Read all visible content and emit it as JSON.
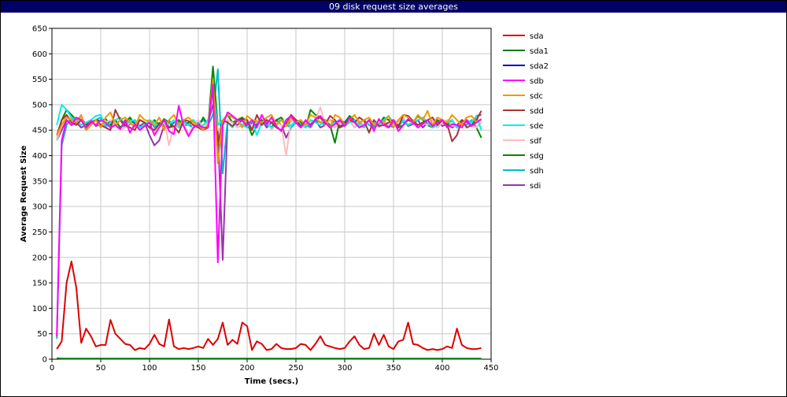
{
  "window": {
    "title": "09 disk request size averages"
  },
  "chart_data": {
    "type": "line",
    "title": "09 disk request size averages",
    "xlabel": "Time (secs.)",
    "ylabel": "Average Request Size",
    "xlim": [
      0,
      450
    ],
    "ylim": [
      0,
      650
    ],
    "x_ticks": [
      0,
      50,
      100,
      150,
      200,
      250,
      300,
      350,
      400,
      450
    ],
    "y_ticks": [
      0,
      50,
      100,
      150,
      200,
      250,
      300,
      350,
      400,
      450,
      500,
      550,
      600,
      650
    ],
    "grid": true,
    "legend_position": "right",
    "x": [
      5,
      10,
      15,
      20,
      25,
      30,
      35,
      40,
      45,
      50,
      55,
      60,
      65,
      70,
      75,
      80,
      85,
      90,
      95,
      100,
      105,
      110,
      115,
      120,
      125,
      130,
      135,
      140,
      145,
      150,
      155,
      160,
      165,
      170,
      175,
      180,
      185,
      190,
      195,
      200,
      205,
      210,
      215,
      220,
      225,
      230,
      235,
      240,
      245,
      250,
      255,
      260,
      265,
      270,
      275,
      280,
      285,
      290,
      295,
      300,
      305,
      310,
      315,
      320,
      325,
      330,
      335,
      340,
      345,
      350,
      355,
      360,
      365,
      370,
      375,
      380,
      385,
      390,
      395,
      400,
      405,
      410,
      415,
      420,
      425,
      430,
      435,
      440
    ],
    "series": [
      {
        "name": "sda",
        "color": "#dd0000",
        "values": [
          20,
          35,
          150,
          192,
          140,
          32,
          60,
          45,
          25,
          28,
          28,
          77,
          50,
          40,
          30,
          28,
          18,
          22,
          20,
          30,
          48,
          30,
          25,
          78,
          25,
          20,
          22,
          20,
          22,
          25,
          22,
          40,
          28,
          40,
          72,
          28,
          38,
          30,
          72,
          65,
          18,
          35,
          30,
          18,
          20,
          30,
          22,
          20,
          20,
          22,
          30,
          28,
          18,
          30,
          45,
          28,
          25,
          22,
          20,
          22,
          35,
          45,
          28,
          20,
          22,
          50,
          28,
          48,
          25,
          20,
          35,
          38,
          72,
          30,
          28,
          22,
          18,
          20,
          18,
          20,
          25,
          22,
          60,
          28,
          22,
          20,
          20,
          22
        ]
      },
      {
        "name": "sda1",
        "color": "#007700",
        "values": [
          2,
          1,
          1,
          1,
          1,
          1,
          1,
          1,
          1,
          1,
          1,
          1,
          1,
          1,
          1,
          1,
          1,
          1,
          1,
          1,
          1,
          1,
          1,
          1,
          1,
          1,
          1,
          1,
          1,
          1,
          1,
          1,
          1,
          1,
          1,
          1,
          1,
          1,
          1,
          1,
          1,
          1,
          1,
          1,
          1,
          1,
          1,
          1,
          1,
          1,
          1,
          1,
          1,
          1,
          1,
          1,
          1,
          1,
          1,
          1,
          1,
          1,
          1,
          1,
          1,
          1,
          1,
          1,
          1,
          1,
          1,
          1,
          1,
          1,
          1,
          1,
          1,
          1,
          1,
          1,
          1,
          1,
          1,
          1,
          1,
          1,
          1,
          1
        ]
      },
      {
        "name": "sda2",
        "color": "#0000cc",
        "values": [
          1,
          1,
          1,
          1,
          1,
          1,
          1,
          1,
          1,
          1,
          1,
          1,
          1,
          1,
          1,
          1,
          1,
          1,
          1,
          1,
          1,
          1,
          1,
          1,
          1,
          1,
          1,
          1,
          1,
          1,
          1,
          1,
          1,
          1,
          1,
          1,
          1,
          1,
          1,
          1,
          1,
          1,
          1,
          1,
          1,
          1,
          1,
          1,
          1,
          1,
          1,
          1,
          1,
          1,
          1,
          1,
          1,
          1,
          1,
          1,
          1,
          1,
          1,
          1,
          1,
          1,
          1,
          1,
          1,
          1,
          1,
          1,
          1,
          1,
          1,
          1,
          1,
          1,
          1,
          1,
          1,
          1,
          1,
          1,
          1,
          1,
          1,
          1
        ]
      },
      {
        "name": "sdb",
        "color": "#ff00ff",
        "values": [
          45,
          430,
          470,
          460,
          475,
          470,
          455,
          468,
          460,
          470,
          465,
          455,
          460,
          452,
          470,
          445,
          462,
          450,
          458,
          465,
          440,
          455,
          470,
          448,
          442,
          498,
          458,
          438,
          455,
          460,
          455,
          455,
          540,
          190,
          460,
          485,
          478,
          470,
          468,
          460,
          470,
          455,
          480,
          462,
          475,
          458,
          448,
          470,
          478,
          465,
          455,
          470,
          458,
          472,
          478,
          465,
          455,
          462,
          470,
          458,
          475,
          465,
          455,
          460,
          470,
          448,
          472,
          460,
          455,
          470,
          448,
          460,
          472,
          465,
          455,
          462,
          470,
          458,
          465,
          470,
          455,
          462,
          460,
          455,
          470,
          458,
          465,
          472
        ]
      },
      {
        "name": "sdc",
        "color": "#ee9900",
        "values": [
          440,
          460,
          475,
          470,
          465,
          480,
          450,
          460,
          470,
          455,
          475,
          485,
          460,
          470,
          475,
          465,
          455,
          480,
          470,
          468,
          460,
          475,
          450,
          470,
          480,
          460,
          470,
          475,
          465,
          460,
          450,
          460,
          550,
          385,
          470,
          480,
          475,
          470,
          455,
          478,
          470,
          468,
          465,
          475,
          480,
          460,
          470,
          458,
          475,
          465,
          470,
          460,
          480,
          475,
          465,
          470,
          455,
          480,
          475,
          460,
          470,
          480,
          465,
          470,
          475,
          460,
          470,
          465,
          478,
          455,
          470,
          480,
          475,
          465,
          480,
          470,
          488,
          460,
          475,
          470,
          465,
          480,
          470,
          460,
          475,
          478,
          465,
          470
        ]
      },
      {
        "name": "sdd",
        "color": "#aa3333",
        "values": [
          440,
          470,
          480,
          465,
          460,
          470,
          455,
          465,
          470,
          460,
          455,
          450,
          490,
          470,
          460,
          455,
          450,
          470,
          465,
          455,
          450,
          462,
          470,
          455,
          458,
          445,
          470,
          468,
          460,
          455,
          450,
          455,
          540,
          420,
          470,
          465,
          458,
          468,
          472,
          470,
          450,
          480,
          460,
          470,
          465,
          455,
          450,
          462,
          480,
          470,
          458,
          468,
          460,
          470,
          475,
          462,
          478,
          470,
          455,
          460,
          470,
          465,
          475,
          468,
          445,
          470,
          458,
          460,
          465,
          470,
          455,
          480,
          478,
          468,
          460,
          465,
          470,
          475,
          460,
          470,
          462,
          428,
          440,
          470,
          455,
          460,
          470,
          488
        ]
      },
      {
        "name": "sde",
        "color": "#00eeee",
        "values": [
          460,
          500,
          490,
          475,
          470,
          460,
          465,
          470,
          478,
          480,
          455,
          465,
          470,
          475,
          460,
          468,
          470,
          455,
          460,
          470,
          465,
          458,
          470,
          462,
          470,
          455,
          465,
          460,
          470,
          455,
          460,
          470,
          530,
          460,
          470,
          465,
          455,
          470,
          460,
          455,
          470,
          440,
          465,
          470,
          455,
          460,
          470,
          465,
          458,
          470,
          462,
          455,
          470,
          465,
          460,
          470,
          455,
          465,
          470,
          458,
          465,
          470,
          460,
          455,
          470,
          465,
          460,
          470,
          478,
          465,
          455,
          470,
          460,
          465,
          470,
          475,
          465,
          455,
          460,
          470,
          465,
          470,
          455,
          460,
          470,
          465,
          478,
          450
        ]
      },
      {
        "name": "sdf",
        "color": "#ffbbbb",
        "values": [
          430,
          460,
          480,
          470,
          465,
          475,
          455,
          460,
          470,
          455,
          465,
          470,
          460,
          450,
          455,
          465,
          460,
          470,
          465,
          455,
          445,
          460,
          470,
          420,
          460,
          455,
          465,
          440,
          460,
          470,
          455,
          465,
          520,
          450,
          460,
          470,
          465,
          455,
          460,
          470,
          455,
          468,
          460,
          470,
          450,
          465,
          460,
          400,
          470,
          465,
          455,
          460,
          468,
          470,
          495,
          460,
          470,
          455,
          465,
          460,
          470,
          455,
          468,
          460,
          470,
          465,
          455,
          468,
          460,
          470,
          465,
          475,
          460,
          470,
          455,
          465,
          460,
          470,
          455,
          465,
          470,
          460,
          455,
          465,
          470,
          460,
          455,
          465
        ]
      },
      {
        "name": "sdg",
        "color": "#008800",
        "values": [
          430,
          470,
          490,
          480,
          470,
          475,
          460,
          465,
          470,
          468,
          472,
          460,
          470,
          455,
          465,
          475,
          460,
          470,
          465,
          455,
          470,
          460,
          472,
          465,
          455,
          470,
          460,
          465,
          470,
          455,
          475,
          460,
          575,
          460,
          470,
          480,
          465,
          470,
          475,
          465,
          440,
          460,
          470,
          465,
          455,
          470,
          475,
          460,
          468,
          470,
          465,
          455,
          490,
          480,
          475,
          470,
          460,
          425,
          470,
          465,
          478,
          470,
          460,
          455,
          470,
          465,
          460,
          475,
          470,
          465,
          455,
          460,
          470,
          465,
          478,
          470,
          460,
          455,
          470,
          465,
          460,
          470,
          455,
          465,
          470,
          460,
          455,
          435
        ]
      },
      {
        "name": "sdh",
        "color": "#00bbcc",
        "values": [
          40,
          420,
          460,
          475,
          465,
          470,
          450,
          460,
          470,
          475,
          460,
          465,
          470,
          455,
          460,
          470,
          465,
          455,
          460,
          470,
          455,
          465,
          460,
          470,
          455,
          465,
          470,
          460,
          455,
          465,
          470,
          460,
          480,
          570,
          365,
          470,
          465,
          455,
          460,
          470,
          455,
          465,
          470,
          460,
          455,
          465,
          470,
          460,
          455,
          465,
          470,
          460,
          455,
          470,
          465,
          460,
          470,
          455,
          465,
          460,
          470,
          455,
          465,
          470,
          460,
          455,
          470,
          465,
          460,
          455,
          470,
          465,
          460,
          470,
          455,
          465,
          460,
          470,
          455,
          465,
          460,
          470,
          455,
          465,
          460,
          470,
          455,
          465
        ]
      },
      {
        "name": "sdi",
        "color": "#9933aa",
        "values": [
          430,
          450,
          470,
          460,
          465,
          455,
          460,
          470,
          458,
          462,
          455,
          468,
          460,
          470,
          455,
          462,
          470,
          458,
          465,
          440,
          420,
          430,
          460,
          455,
          465,
          470,
          458,
          462,
          455,
          460,
          470,
          465,
          500,
          450,
          195,
          470,
          465,
          460,
          470,
          455,
          465,
          460,
          470,
          455,
          465,
          470,
          460,
          435,
          455,
          470,
          465,
          458,
          462,
          470,
          455,
          460,
          470,
          465,
          458,
          462,
          470,
          455,
          465,
          460,
          470,
          458,
          462,
          470,
          455,
          465,
          460,
          470,
          458,
          462,
          470,
          455,
          465,
          460,
          470,
          458,
          462,
          455,
          460,
          470,
          465,
          458,
          478,
          480
        ]
      }
    ]
  }
}
